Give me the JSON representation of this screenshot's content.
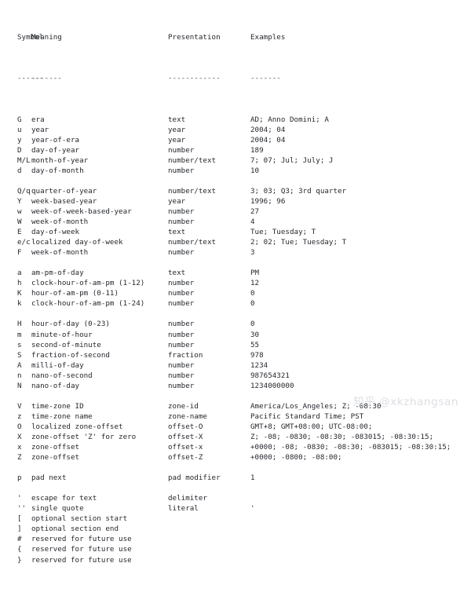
{
  "table": {
    "headers": {
      "symbol": "Symbol",
      "meaning": "Meaning",
      "presentation": "Presentation",
      "examples": "Examples"
    },
    "rules": {
      "symbol": "------",
      "meaning": "-------",
      "presentation": "------------",
      "examples": "-------"
    },
    "rows": [
      {
        "symbol": "G",
        "meaning": "era",
        "presentation": "text",
        "examples": "AD; Anno Domini; A"
      },
      {
        "symbol": "u",
        "meaning": "year",
        "presentation": "year",
        "examples": "2004; 04"
      },
      {
        "symbol": "y",
        "meaning": "year-of-era",
        "presentation": "year",
        "examples": "2004; 04"
      },
      {
        "symbol": "D",
        "meaning": "day-of-year",
        "presentation": "number",
        "examples": "189"
      },
      {
        "symbol": "M/L",
        "meaning": "month-of-year",
        "presentation": "number/text",
        "examples": "7; 07; Jul; July; J"
      },
      {
        "symbol": "d",
        "meaning": "day-of-month",
        "presentation": "number",
        "examples": "10"
      },
      {
        "spacer": true
      },
      {
        "symbol": "Q/q",
        "meaning": "quarter-of-year",
        "presentation": "number/text",
        "examples": "3; 03; Q3; 3rd quarter"
      },
      {
        "symbol": "Y",
        "meaning": "week-based-year",
        "presentation": "year",
        "examples": "1996; 96"
      },
      {
        "symbol": "w",
        "meaning": "week-of-week-based-year",
        "presentation": "number",
        "examples": "27"
      },
      {
        "symbol": "W",
        "meaning": "week-of-month",
        "presentation": "number",
        "examples": "4"
      },
      {
        "symbol": "E",
        "meaning": "day-of-week",
        "presentation": "text",
        "examples": "Tue; Tuesday; T"
      },
      {
        "symbol": "e/c",
        "meaning": "localized day-of-week",
        "presentation": "number/text",
        "examples": "2; 02; Tue; Tuesday; T"
      },
      {
        "symbol": "F",
        "meaning": "week-of-month",
        "presentation": "number",
        "examples": "3"
      },
      {
        "spacer": true
      },
      {
        "symbol": "a",
        "meaning": "am-pm-of-day",
        "presentation": "text",
        "examples": "PM"
      },
      {
        "symbol": "h",
        "meaning": "clock-hour-of-am-pm (1-12)",
        "presentation": "number",
        "examples": "12"
      },
      {
        "symbol": "K",
        "meaning": "hour-of-am-pm (0-11)",
        "presentation": "number",
        "examples": "0"
      },
      {
        "symbol": "k",
        "meaning": "clock-hour-of-am-pm (1-24)",
        "presentation": "number",
        "examples": "0"
      },
      {
        "spacer": true
      },
      {
        "symbol": "H",
        "meaning": "hour-of-day (0-23)",
        "presentation": "number",
        "examples": "0"
      },
      {
        "symbol": "m",
        "meaning": "minute-of-hour",
        "presentation": "number",
        "examples": "30"
      },
      {
        "symbol": "s",
        "meaning": "second-of-minute",
        "presentation": "number",
        "examples": "55"
      },
      {
        "symbol": "S",
        "meaning": "fraction-of-second",
        "presentation": "fraction",
        "examples": "978"
      },
      {
        "symbol": "A",
        "meaning": "milli-of-day",
        "presentation": "number",
        "examples": "1234"
      },
      {
        "symbol": "n",
        "meaning": "nano-of-second",
        "presentation": "number",
        "examples": "987654321"
      },
      {
        "symbol": "N",
        "meaning": "nano-of-day",
        "presentation": "number",
        "examples": "1234000000"
      },
      {
        "spacer": true
      },
      {
        "symbol": "V",
        "meaning": "time-zone ID",
        "presentation": "zone-id",
        "examples": "America/Los_Angeles; Z; -08:30"
      },
      {
        "symbol": "z",
        "meaning": "time-zone name",
        "presentation": "zone-name",
        "examples": "Pacific Standard Time; PST"
      },
      {
        "symbol": "O",
        "meaning": "localized zone-offset",
        "presentation": "offset-O",
        "examples": "GMT+8; GMT+08:00; UTC-08:00;"
      },
      {
        "symbol": "X",
        "meaning": "zone-offset 'Z' for zero",
        "presentation": "offset-X",
        "examples": "Z; -08; -0830; -08:30; -083015; -08:30:15;"
      },
      {
        "symbol": "x",
        "meaning": "zone-offset",
        "presentation": "offset-x",
        "examples": "+0000; -08; -0830; -08:30; -083015; -08:30:15;"
      },
      {
        "symbol": "Z",
        "meaning": "zone-offset",
        "presentation": "offset-Z",
        "examples": "+0000; -0800; -08:00;"
      },
      {
        "spacer": true
      },
      {
        "symbol": "p",
        "meaning": "pad next",
        "presentation": "pad modifier",
        "examples": "1"
      },
      {
        "spacer": true
      },
      {
        "symbol": "'",
        "meaning": "escape for text",
        "presentation": "delimiter",
        "examples": ""
      },
      {
        "symbol": "''",
        "meaning": "single quote",
        "presentation": "literal",
        "examples": "'"
      },
      {
        "symbol": "[",
        "meaning": "optional section start",
        "presentation": "",
        "examples": ""
      },
      {
        "symbol": "]",
        "meaning": "optional section end",
        "presentation": "",
        "examples": ""
      },
      {
        "symbol": "#",
        "meaning": "reserved for future use",
        "presentation": "",
        "examples": ""
      },
      {
        "symbol": "{",
        "meaning": "reserved for future use",
        "presentation": "",
        "examples": ""
      },
      {
        "symbol": "}",
        "meaning": "reserved for future use",
        "presentation": "",
        "examples": ""
      }
    ]
  },
  "watermark": {
    "text": "知乎 @xkzhangsan"
  },
  "colors": {
    "background": "#ffffff",
    "text": "#25282d",
    "rule": "#4a4f56",
    "watermark": "#dcdee1"
  }
}
